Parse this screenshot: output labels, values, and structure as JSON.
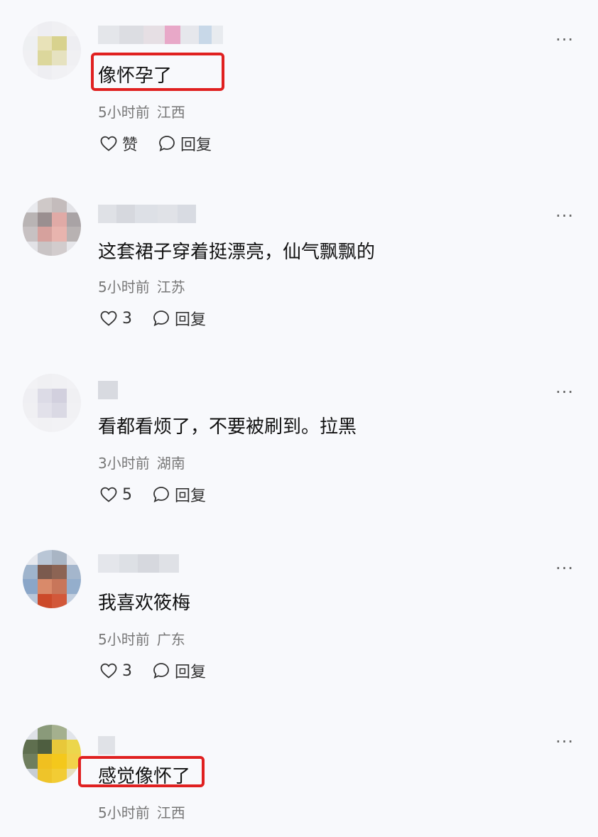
{
  "comments": [
    {
      "text": "像怀孕了",
      "time": "5小时前",
      "location": "江西",
      "like_label": "赞",
      "reply_label": "回复",
      "highlighted": true
    },
    {
      "text": "这套裙子穿着挺漂亮，仙气飘飘的",
      "time": "5小时前",
      "location": "江苏",
      "like_label": "3",
      "reply_label": "回复",
      "highlighted": false
    },
    {
      "text": "看都看烦了，不要被刷到。拉黑",
      "time": "3小时前",
      "location": "湖南",
      "like_label": "5",
      "reply_label": "回复",
      "highlighted": false
    },
    {
      "text": "我喜欢筱梅",
      "time": "5小时前",
      "location": "广东",
      "like_label": "3",
      "reply_label": "回复",
      "highlighted": false
    },
    {
      "text": "感觉像怀了",
      "time": "5小时前",
      "location": "江西",
      "like_label": "",
      "reply_label": "",
      "highlighted": true
    }
  ],
  "more_label": "···",
  "colors": {
    "highlight": "#e02020",
    "meta": "#777777",
    "background": "#f8f9fc"
  }
}
